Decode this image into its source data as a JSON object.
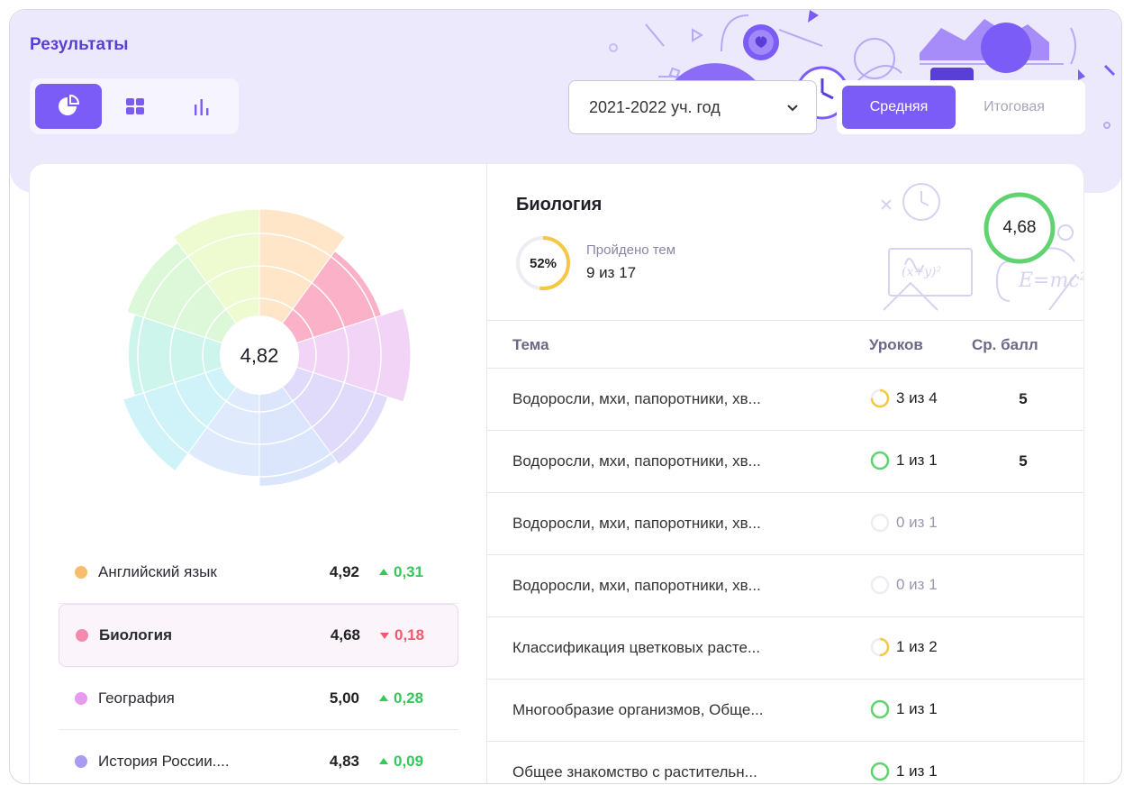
{
  "page": {
    "title": "Результаты"
  },
  "view_switch": {
    "items": [
      "pie-view",
      "grid-view",
      "bar-view"
    ],
    "active": "pie-view"
  },
  "year_select": {
    "value": "2021-2022 уч. год"
  },
  "mode_switch": {
    "active_label": "Средняя",
    "inactive_label": "Итоговая"
  },
  "colors": {
    "accent": "#7c5cf6",
    "positive": "#34c759",
    "negative": "#ef5a6f",
    "ring_green": "#5fd36f",
    "ring_yellow": "#f5c842"
  },
  "rose": {
    "center_value": "4,82",
    "segments": [
      {
        "color": "#ffe6c8",
        "level": 1.08
      },
      {
        "color": "#fbb1c8",
        "level": 0.95
      },
      {
        "color": "#f2d4f6",
        "level": 1.12
      },
      {
        "color": "#e0dafb",
        "level": 1.0
      },
      {
        "color": "#dbe6fc",
        "level": 0.97
      },
      {
        "color": "#dfeafd",
        "level": 0.9
      },
      {
        "color": "#cff3f8",
        "level": 1.06
      },
      {
        "color": "#cdf5ec",
        "level": 0.97
      },
      {
        "color": "#dcf8d8",
        "level": 1.03
      },
      {
        "color": "#eefad0",
        "level": 1.08
      }
    ]
  },
  "subjects": [
    {
      "name": "Английский язык",
      "color": "#f8bd6c",
      "score": "4,92",
      "delta": "0,31",
      "trend": "up",
      "selected": false
    },
    {
      "name": "Биология",
      "color": "#f28aae",
      "score": "4,68",
      "delta": "0,18",
      "trend": "down",
      "selected": true
    },
    {
      "name": "География",
      "color": "#e79af0",
      "score": "5,00",
      "delta": "0,28",
      "trend": "up",
      "selected": false
    },
    {
      "name": "История России....",
      "color": "#a99bf0",
      "score": "4,83",
      "delta": "0,09",
      "trend": "up",
      "selected": false
    }
  ],
  "subject_detail": {
    "title": "Биология",
    "progress_percent": "52%",
    "progress_fraction": 0.52,
    "progress_label": "Пройдено тем",
    "progress_value": "9 из 17",
    "average": "4,68"
  },
  "table": {
    "headers": {
      "topic": "Тема",
      "lessons": "Уроков",
      "grade": "Ср. балл"
    },
    "rows": [
      {
        "topic": "Водоросли, мхи, папоротники, хв...",
        "lessons": "3 из 4",
        "fraction": 0.75,
        "ring": "yellow",
        "grade": "5"
      },
      {
        "topic": "Водоросли, мхи, папоротники, хв...",
        "lessons": "1 из 1",
        "fraction": 1.0,
        "ring": "green",
        "grade": "5"
      },
      {
        "topic": "Водоросли, мхи, папоротники, хв...",
        "lessons": "0 из 1",
        "fraction": 0.0,
        "ring": "gray",
        "grade": ""
      },
      {
        "topic": "Водоросли, мхи, папоротники, хв...",
        "lessons": "0 из 1",
        "fraction": 0.0,
        "ring": "gray",
        "grade": ""
      },
      {
        "topic": "Классификация цветковых расте...",
        "lessons": "1 из 2",
        "fraction": 0.5,
        "ring": "yellow",
        "grade": ""
      },
      {
        "topic": "Многообразие организмов, Обще...",
        "lessons": "1 из 1",
        "fraction": 1.0,
        "ring": "green",
        "grade": ""
      },
      {
        "topic": "Общее знакомство с растительн...",
        "lessons": "1 из 1",
        "fraction": 1.0,
        "ring": "green",
        "grade": ""
      }
    ]
  }
}
